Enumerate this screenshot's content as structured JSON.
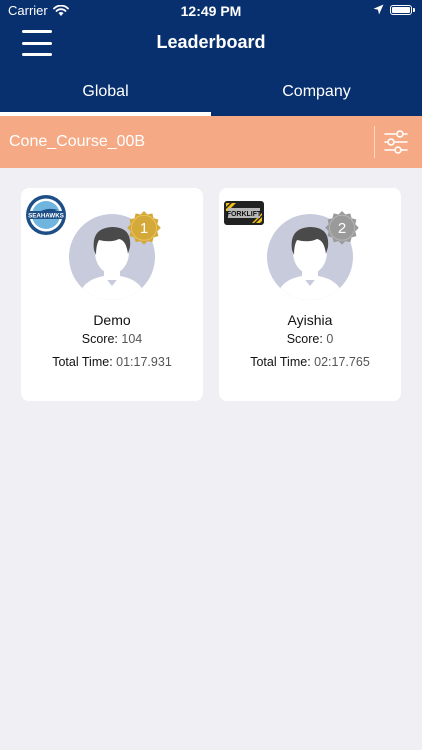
{
  "status_bar": {
    "carrier": "Carrier",
    "time": "12:49 PM"
  },
  "header": {
    "title": "Leaderboard"
  },
  "tabs": [
    {
      "label": "Global",
      "active": true
    },
    {
      "label": "Company",
      "active": false
    }
  ],
  "course": {
    "name": "Cone_Course_00B"
  },
  "colors": {
    "header": "#08306e",
    "course_bar": "#f5aa85",
    "gold": "#d4a93a",
    "silver": "#9a9a9a"
  },
  "leaders": [
    {
      "rank": "1",
      "name": "Demo",
      "score_label": "Score:",
      "score": "104",
      "time_label": "Total Time:",
      "time": "01:17.931",
      "logo": "seahawks-logo",
      "logo_text": "SEAHAWKS"
    },
    {
      "rank": "2",
      "name": "Ayishia",
      "score_label": "Score:",
      "score": "0",
      "time_label": "Total Time:",
      "time": "02:17.765",
      "logo": "forklift-logo",
      "logo_text": "FORKLIFT"
    }
  ]
}
